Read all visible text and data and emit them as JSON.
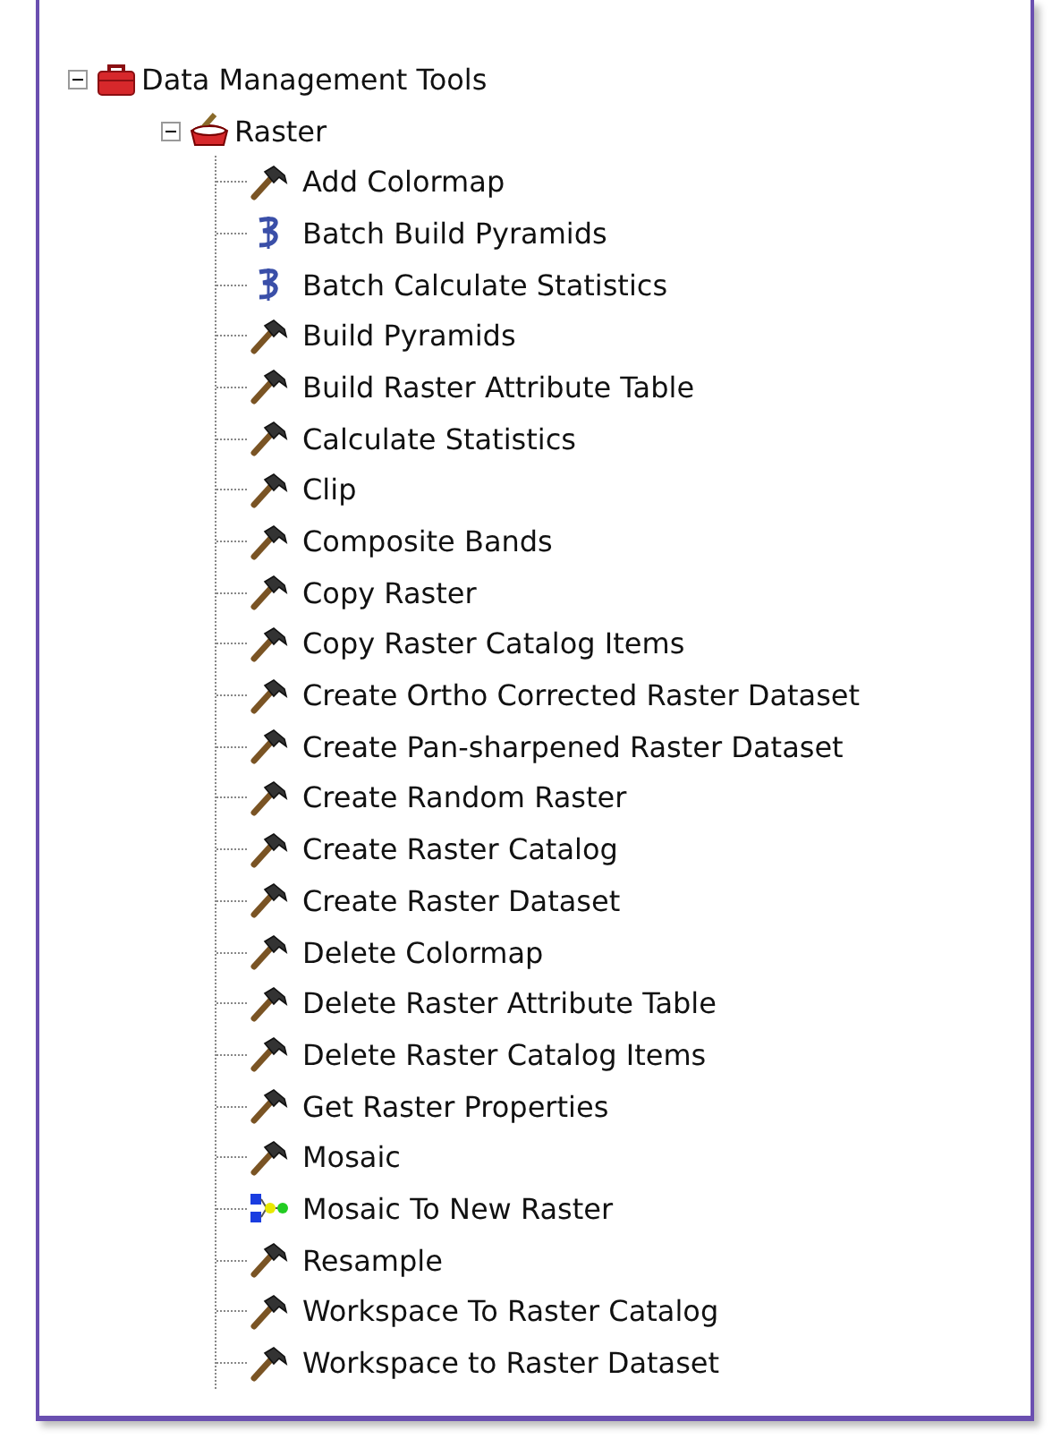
{
  "tree": [
    {
      "label": "Data Management Tools",
      "kind": "toolbox",
      "expanded": true,
      "children": [
        {
          "label": "Raster",
          "kind": "toolset",
          "expanded": true,
          "children": [
            {
              "label": "Add Colormap",
              "kind": "tool"
            },
            {
              "label": "Batch Build Pyramids",
              "kind": "script"
            },
            {
              "label": "Batch Calculate Statistics",
              "kind": "script"
            },
            {
              "label": "Build Pyramids",
              "kind": "tool"
            },
            {
              "label": "Build Raster Attribute Table",
              "kind": "tool"
            },
            {
              "label": "Calculate Statistics",
              "kind": "tool"
            },
            {
              "label": "Clip",
              "kind": "tool"
            },
            {
              "label": "Composite Bands",
              "kind": "tool"
            },
            {
              "label": "Copy Raster",
              "kind": "tool"
            },
            {
              "label": "Copy Raster Catalog Items",
              "kind": "tool"
            },
            {
              "label": "Create Ortho Corrected Raster Dataset",
              "kind": "tool"
            },
            {
              "label": "Create Pan-sharpened Raster Dataset",
              "kind": "tool"
            },
            {
              "label": "Create Random Raster",
              "kind": "tool"
            },
            {
              "label": "Create Raster Catalog",
              "kind": "tool"
            },
            {
              "label": "Create Raster Dataset",
              "kind": "tool"
            },
            {
              "label": "Delete Colormap",
              "kind": "tool"
            },
            {
              "label": "Delete Raster Attribute Table",
              "kind": "tool"
            },
            {
              "label": "Delete Raster Catalog Items",
              "kind": "tool"
            },
            {
              "label": "Get Raster Properties",
              "kind": "tool"
            },
            {
              "label": "Mosaic",
              "kind": "tool"
            },
            {
              "label": "Mosaic To New Raster",
              "kind": "model"
            },
            {
              "label": "Resample",
              "kind": "tool"
            },
            {
              "label": "Workspace To Raster Catalog",
              "kind": "tool"
            },
            {
              "label": "Workspace to Raster Dataset",
              "kind": "tool"
            }
          ]
        }
      ]
    }
  ]
}
